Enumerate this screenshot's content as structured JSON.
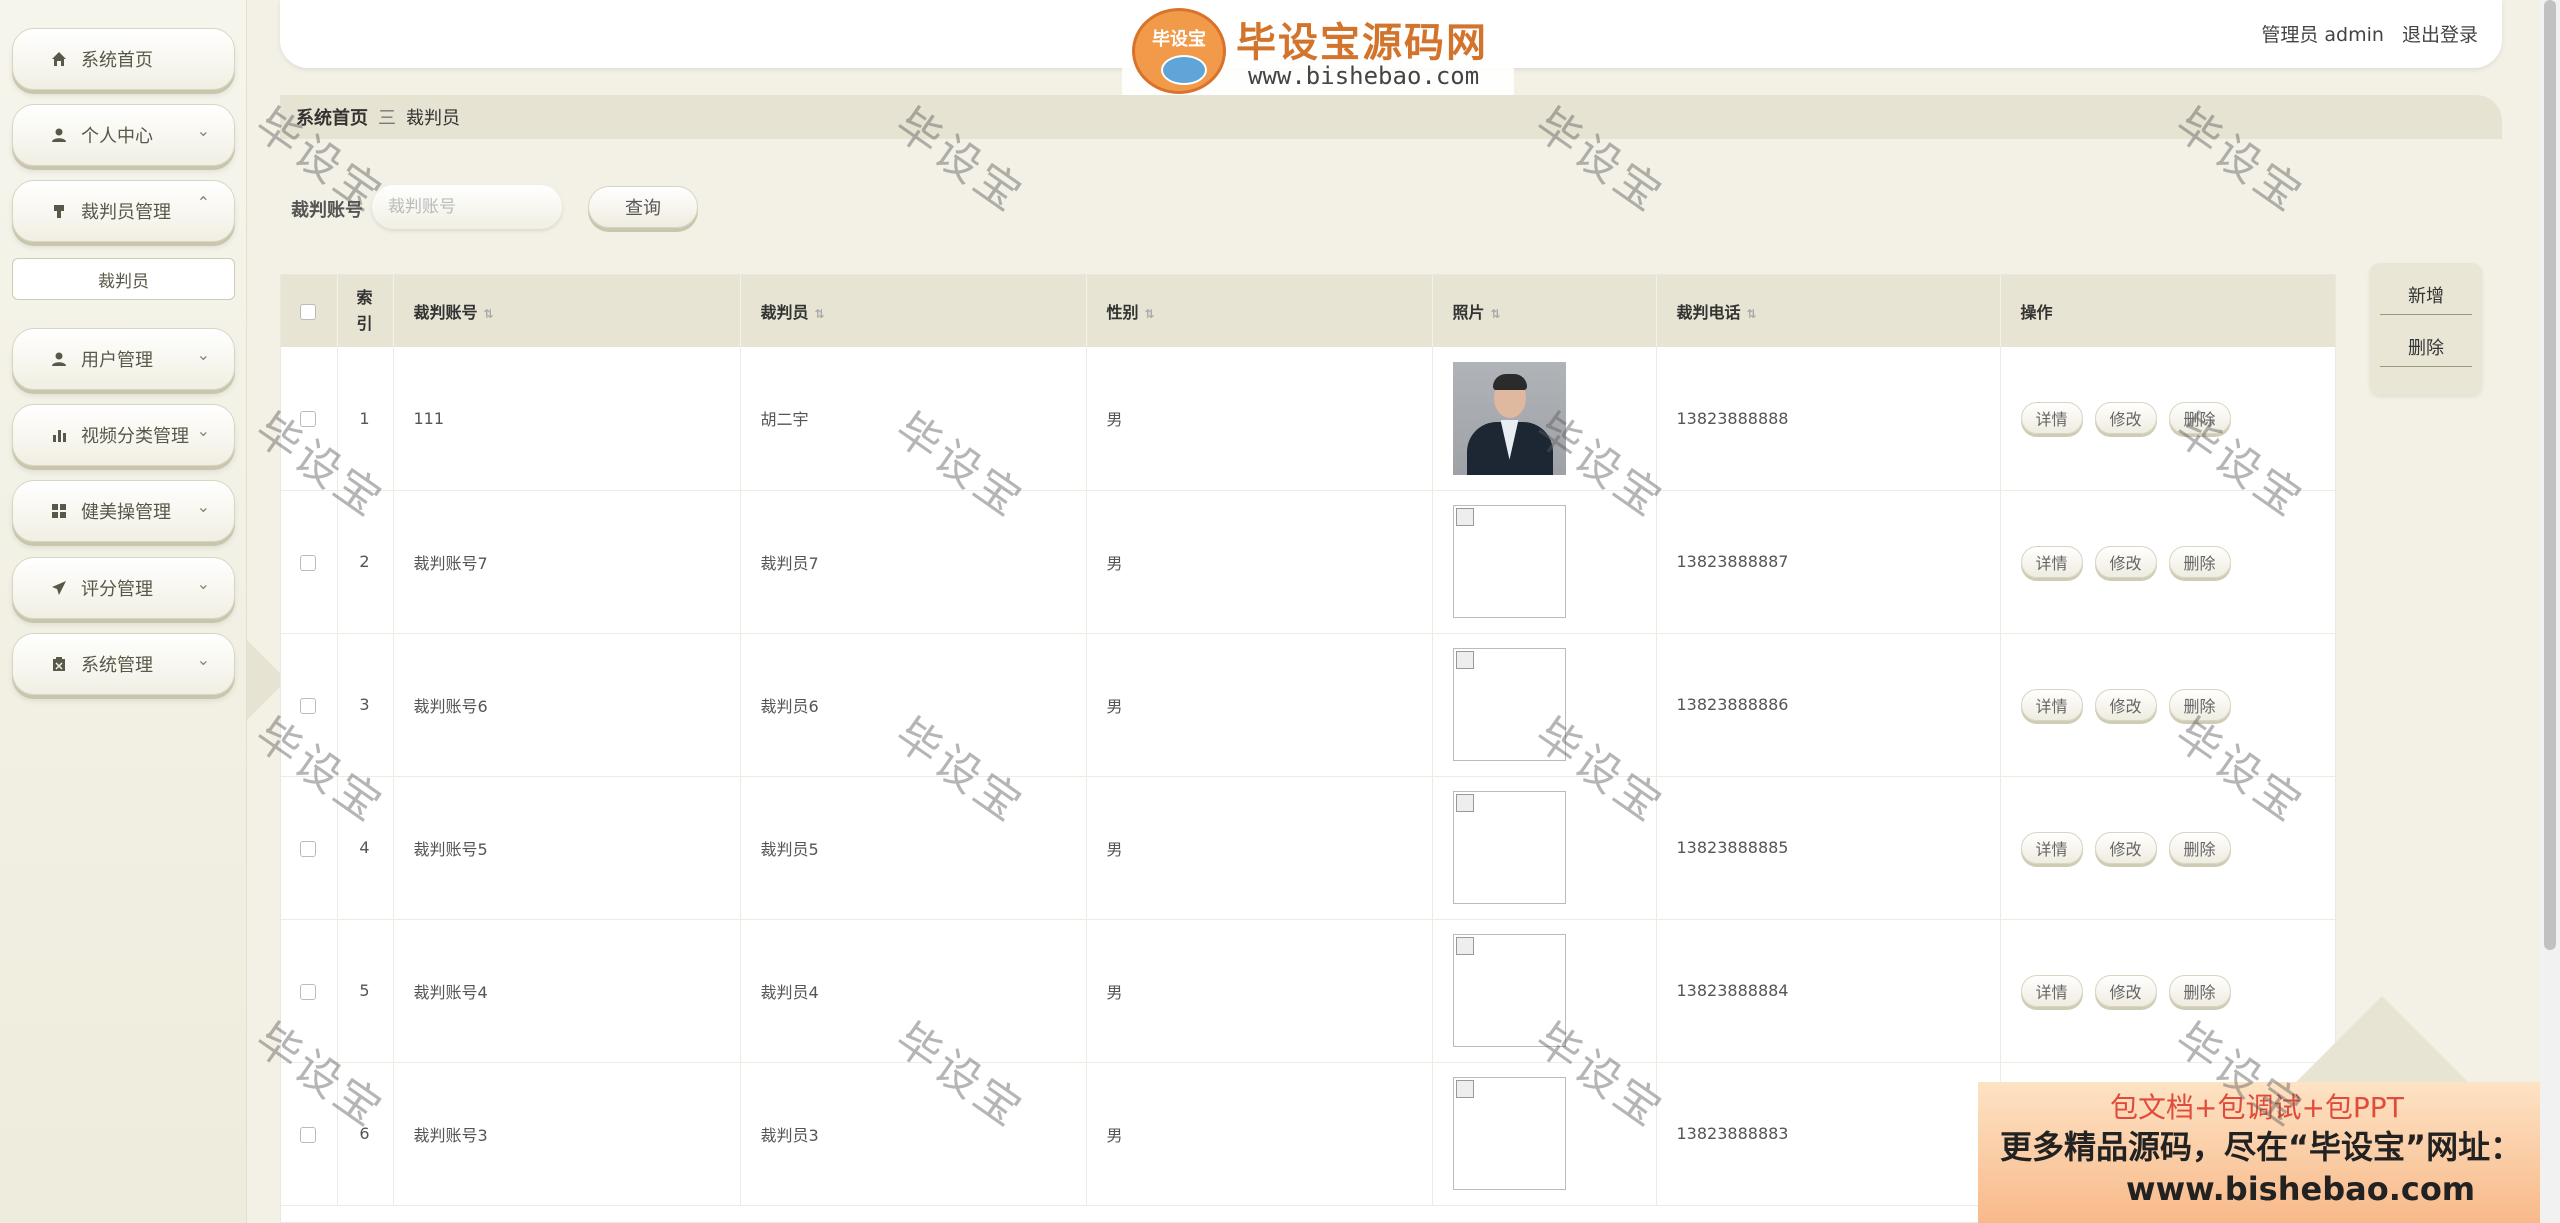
{
  "header": {
    "user_label": "管理员 admin",
    "logout": "退出登录",
    "logo_badge": "毕设宝",
    "logo_title": "毕设宝源码网",
    "logo_url": "www.bishebao.com"
  },
  "sidebar": {
    "items": [
      {
        "label": "系统首页",
        "icon": "home-icon"
      },
      {
        "label": "个人中心",
        "icon": "user-icon"
      },
      {
        "label": "裁判员管理",
        "icon": "stamp-icon"
      },
      {
        "label": "用户管理",
        "icon": "user-icon"
      },
      {
        "label": "视频分类管理",
        "icon": "bar-chart-icon"
      },
      {
        "label": "健美操管理",
        "icon": "grid-icon"
      },
      {
        "label": "评分管理",
        "icon": "send-icon"
      },
      {
        "label": "系统管理",
        "icon": "clipboard-icon"
      }
    ],
    "sub_item": "裁判员"
  },
  "breadcrumb": {
    "home": "系统首页",
    "current": "裁判员",
    "separator": "三"
  },
  "search": {
    "label": "裁判账号",
    "placeholder": "裁判账号",
    "button": "查询"
  },
  "actions": {
    "add": "新增",
    "delete": "删除"
  },
  "table": {
    "headers": [
      "索引",
      "裁判账号",
      "裁判员",
      "性别",
      "照片",
      "裁判电话",
      "操作"
    ],
    "ops": [
      "详情",
      "修改",
      "删除"
    ],
    "rows": [
      {
        "index": "1",
        "account": "111",
        "name": "胡二宇",
        "gender": "男",
        "phone": "13823888888",
        "photo": "real"
      },
      {
        "index": "2",
        "account": "裁判账号7",
        "name": "裁判员7",
        "gender": "男",
        "phone": "13823888887",
        "photo": "broken"
      },
      {
        "index": "3",
        "account": "裁判账号6",
        "name": "裁判员6",
        "gender": "男",
        "phone": "13823888886",
        "photo": "broken"
      },
      {
        "index": "4",
        "account": "裁判账号5",
        "name": "裁判员5",
        "gender": "男",
        "phone": "13823888885",
        "photo": "broken"
      },
      {
        "index": "5",
        "account": "裁判账号4",
        "name": "裁判员4",
        "gender": "男",
        "phone": "13823888884",
        "photo": "broken"
      },
      {
        "index": "6",
        "account": "裁判账号3",
        "name": "裁判员3",
        "gender": "男",
        "phone": "13823888883",
        "photo": "broken"
      }
    ]
  },
  "ad": {
    "line1": "包文档+包调试+包PPT",
    "line2": "更多精品源码，尽在“毕设宝”网址：",
    "line3": "www.bishebao.com"
  },
  "watermark": "毕设宝",
  "colors": {
    "background": "#f3f1e6",
    "header_bar": "#e7e4d3",
    "accent": "#d2742c"
  }
}
